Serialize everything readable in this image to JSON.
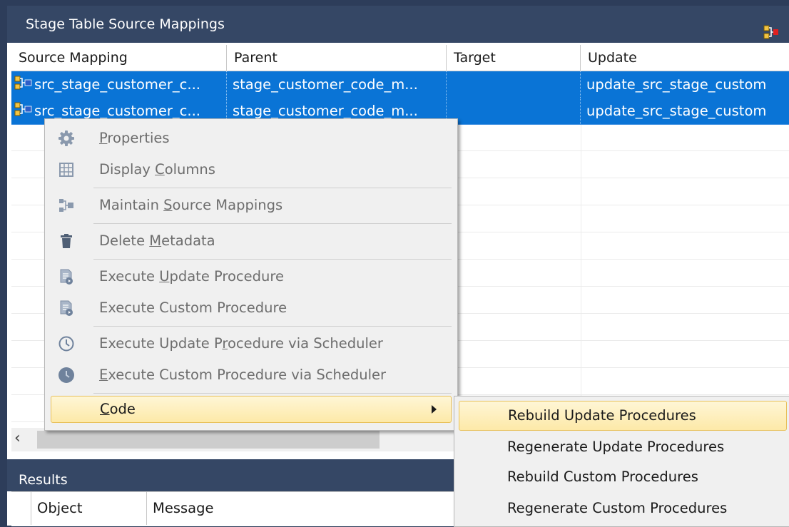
{
  "panel": {
    "title": "Stage Table Source Mappings",
    "header_icon": "source-mapping-icon"
  },
  "grid": {
    "columns": [
      "Source Mapping",
      "Parent",
      "Target",
      "Update"
    ],
    "rows": [
      {
        "source_mapping": "src_stage_customer_c...",
        "parent": "stage_customer_code_m...",
        "target": "",
        "update": "update_src_stage_custom"
      },
      {
        "source_mapping": "src_stage_customer_c...",
        "parent": "stage_customer_code_m...",
        "target": "",
        "update": "update_src_stage_custom"
      }
    ]
  },
  "context_menu": {
    "items": [
      {
        "pre": "",
        "key": "P",
        "post": "roperties",
        "icon": "gear-icon"
      },
      {
        "pre": "Display ",
        "key": "C",
        "post": "olumns",
        "icon": "grid-icon"
      },
      {
        "pre": "Maintain ",
        "key": "S",
        "post": "ource Mappings",
        "icon": "source-mapping-icon"
      },
      {
        "pre": "Delete ",
        "key": "M",
        "post": "etadata",
        "icon": "trash-icon"
      },
      {
        "pre": "Execute ",
        "key": "U",
        "post": "pdate Procedure",
        "icon": "execute-procedure-icon"
      },
      {
        "pre": "Execute Custom Procedure",
        "key": "",
        "post": "",
        "icon": "execute-procedure-icon"
      },
      {
        "pre": "Execute Update P",
        "key": "r",
        "post": "ocedure via Scheduler",
        "icon": "clock-outline-icon"
      },
      {
        "pre": "",
        "key": "E",
        "post": "xecute Custom Procedure via Scheduler",
        "icon": "clock-filled-icon"
      },
      {
        "pre": "",
        "key": "C",
        "post": "ode",
        "icon": ""
      }
    ]
  },
  "submenu": {
    "items": [
      "Rebuild Update Procedures",
      "Regenerate Update Procedures",
      "Rebuild Custom Procedures",
      "Regenerate Custom Procedures"
    ]
  },
  "results": {
    "title": "Results",
    "columns": [
      "Object",
      "Message"
    ]
  },
  "colors": {
    "header_bg": "#354765",
    "selection": "#0a74d6",
    "menu_highlight": "#fde9a8"
  }
}
